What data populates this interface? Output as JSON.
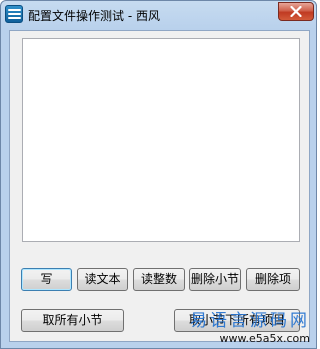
{
  "window": {
    "title": "配置文件操作测试 - 西风",
    "app_icon": "app-stack-icon",
    "close_icon": "close-icon"
  },
  "textbox": {
    "value": ""
  },
  "buttons": {
    "write": "写",
    "read_text": "读文本",
    "read_int": "读整数",
    "delete_section": "删除小节",
    "delete_key": "删除项",
    "get_all_sections": "取所有小节",
    "get_all_keys": "取小节下所有项目"
  },
  "watermark": {
    "text": "易语言源码网",
    "url": "www.e5a5x.com"
  },
  "colors": {
    "titlebar": "#b9d1ec",
    "close_button": "#c8442b",
    "watermark": "#1f6fcf"
  }
}
